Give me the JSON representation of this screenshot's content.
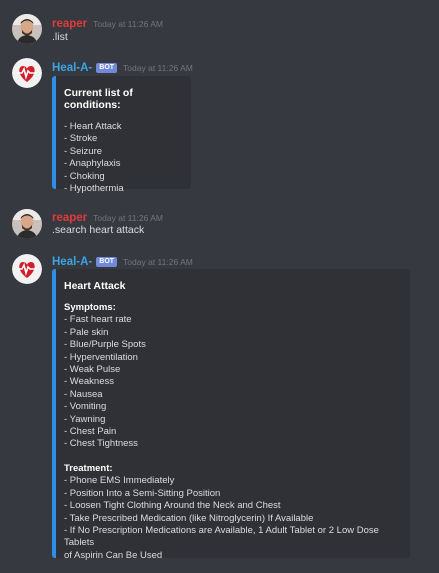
{
  "messages": [
    {
      "author": "reaper",
      "timestamp": "Today at 11:26 AM",
      "text": ".list"
    },
    {
      "author": "Heal-A-",
      "tag": "BOT",
      "timestamp": "Today at 11:26 AM",
      "embed": {
        "title": "Current list of conditions:",
        "items": [
          "- Heart Attack",
          "- Stroke",
          "- Seizure",
          "- Anaphylaxis",
          "- Choking",
          "- Hypothermia"
        ]
      }
    },
    {
      "author": "reaper",
      "timestamp": "Today at 11:26 AM",
      "text": ".search heart attack"
    },
    {
      "author": "Heal-A-",
      "tag": "BOT",
      "timestamp": "Today at 11:26 AM",
      "embed": {
        "title": "Heart Attack",
        "symptoms_label": "Symptoms:",
        "symptoms": [
          "- Fast heart rate",
          "- Pale skin",
          "- Blue/Purple Spots",
          "- Hyperventilation",
          "- Weak Pulse",
          "- Weakness",
          "- Nausea",
          "- Vomiting",
          "- Yawning",
          "- Chest Pain",
          "- Chest Tightness"
        ],
        "treatment_label": "Treatment:",
        "treatment": [
          "- Phone EMS Immediately",
          "- Position Into a Semi-Sitting Position",
          "- Loosen Tight Clothing Around the Neck and Chest",
          "- Take Prescribed Medication (like Nitroglycerin) If Available",
          "- If No Prescription Medications are Available, 1 Adult Tablet or 2 Low Dose Tablets",
          "of Aspirin Can Be Used"
        ]
      }
    }
  ],
  "colors": {
    "background": "#36393f",
    "embed_background": "#2f3136",
    "embed_accent": "#2f8fe6",
    "user_name": "#e03a3a",
    "bot_name": "#3aa6e6",
    "bot_tag": "#7289da"
  },
  "icons": {
    "user_avatar": "person-avatar-icon",
    "bot_avatar": "heartbeat-avatar-icon"
  }
}
